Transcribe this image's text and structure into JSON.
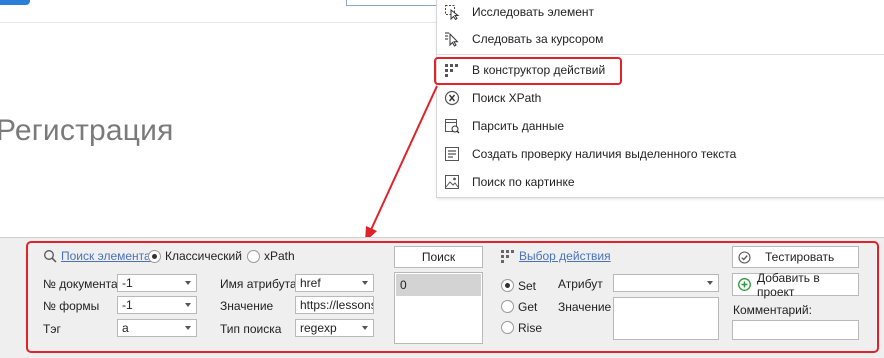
{
  "page": {
    "heading": "Регистрация"
  },
  "context_menu": {
    "items": [
      {
        "label": "Исследовать элемент",
        "icon": "inspect-element-icon"
      },
      {
        "label": "Следовать за курсором",
        "icon": "follow-cursor-icon"
      },
      {
        "label": "В конструктор действий",
        "icon": "action-builder-icon"
      },
      {
        "label": "Поиск XPath",
        "icon": "xpath-icon"
      },
      {
        "label": "Парсить данные",
        "icon": "parse-data-icon"
      },
      {
        "label": "Создать проверку наличия выделенного текста",
        "icon": "text-check-icon"
      },
      {
        "label": "Поиск по картинке",
        "icon": "image-search-icon"
      }
    ]
  },
  "panel": {
    "search_link": "Поиск элемента",
    "mode_classic": "Классический",
    "mode_xpath": "xPath",
    "doc_label": "№ документа",
    "doc_value": "-1",
    "form_label": "№ формы",
    "form_value": "-1",
    "tag_label": "Тэг",
    "tag_value": "a",
    "attr_name_label": "Имя атрибута",
    "attr_name_value": "href",
    "value_label": "Значение",
    "value_value": "https://lessons",
    "search_type_label": "Тип поиска",
    "search_type_value": "regexp",
    "search_button": "Поиск",
    "results": [
      "0"
    ],
    "action_link": "Выбор действия",
    "action_set": "Set",
    "action_get": "Get",
    "action_rise": "Rise",
    "attribute_label": "Атрибут",
    "attribute_value": "",
    "action_value_label": "Значение",
    "test_button": "Тестировать",
    "add_button": "Добавить в проект",
    "comment_label": "Комментарий:",
    "comment_value": ""
  },
  "colors": {
    "highlight": "#e0222a",
    "link": "#4a72b8",
    "accent_green": "#2f9a3c"
  }
}
